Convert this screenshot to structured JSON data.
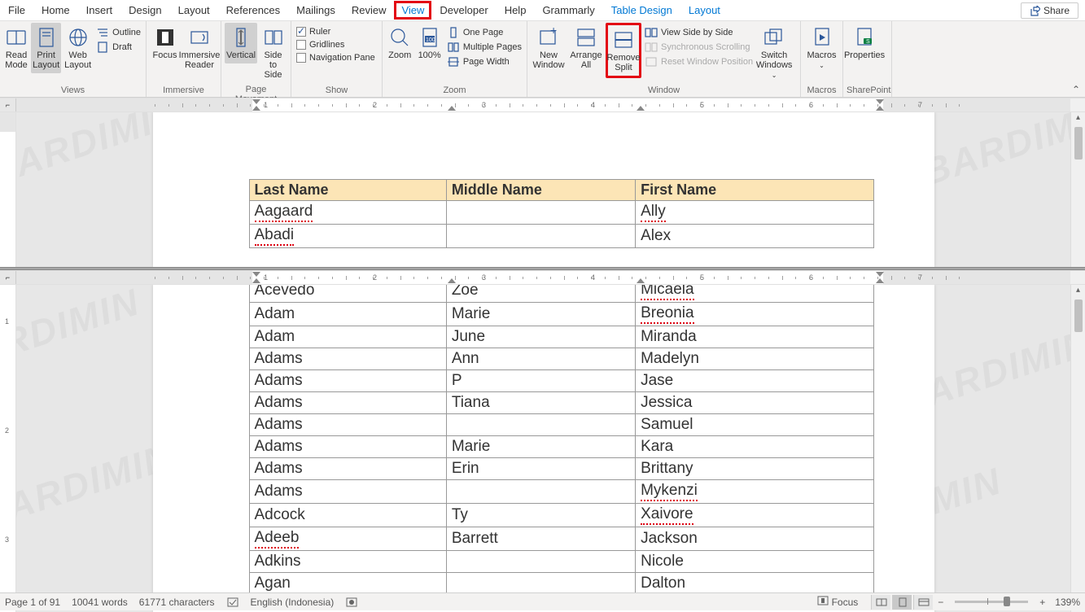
{
  "menu": {
    "items": [
      "File",
      "Home",
      "Insert",
      "Design",
      "Layout",
      "References",
      "Mailings",
      "Review",
      "View",
      "Developer",
      "Help",
      "Grammarly",
      "Table Design",
      "Layout"
    ],
    "share": "Share"
  },
  "ribbon": {
    "groups": {
      "views": {
        "label": "Views",
        "read_mode": "Read Mode",
        "print_layout": "Print Layout",
        "web_layout": "Web Layout",
        "outline": "Outline",
        "draft": "Draft"
      },
      "immersive": {
        "label": "Immersive",
        "focus": "Focus",
        "immersive_reader": "Immersive Reader"
      },
      "page_movement": {
        "label": "Page Movement",
        "vertical": "Vertical",
        "side_to_side": "Side to Side"
      },
      "show": {
        "label": "Show",
        "ruler": "Ruler",
        "gridlines": "Gridlines",
        "navigation_pane": "Navigation Pane"
      },
      "zoom": {
        "label": "Zoom",
        "zoom": "Zoom",
        "p100": "100%",
        "one_page": "One Page",
        "multiple_pages": "Multiple Pages",
        "page_width": "Page Width"
      },
      "window": {
        "label": "Window",
        "new_window": "New Window",
        "arrange_all": "Arrange All",
        "remove_split": "Remove Split",
        "view_side": "View Side by Side",
        "synchronous": "Synchronous Scrolling",
        "reset_position": "Reset Window Position",
        "switch_windows": "Switch Windows"
      },
      "macros": {
        "label": "Macros",
        "macros": "Macros"
      },
      "sharepoint": {
        "label": "SharePoint",
        "properties": "Properties"
      }
    }
  },
  "table": {
    "headers": [
      "Last Name",
      "Middle Name",
      "First Name"
    ],
    "top_rows": [
      {
        "last": "Aagaard",
        "middle": "",
        "first": "Ally",
        "u": [
          0,
          2
        ]
      },
      {
        "last": "Abadi",
        "middle": "",
        "first": "Alex",
        "u": [
          0
        ]
      }
    ],
    "bottom_rows": [
      {
        "last": "Acevedo",
        "middle": "Zoe",
        "first": "Micaela",
        "u": [
          2
        ]
      },
      {
        "last": "Adam",
        "middle": "Marie",
        "first": "Breonia",
        "u": [
          2
        ]
      },
      {
        "last": "Adam",
        "middle": "June",
        "first": "Miranda",
        "u": []
      },
      {
        "last": "Adams",
        "middle": "Ann",
        "first": "Madelyn",
        "u": []
      },
      {
        "last": "Adams",
        "middle": "P",
        "first": "Jase",
        "u": []
      },
      {
        "last": "Adams",
        "middle": "Tiana",
        "first": "Jessica",
        "u": []
      },
      {
        "last": "Adams",
        "middle": "",
        "first": "Samuel",
        "u": []
      },
      {
        "last": "Adams",
        "middle": "Marie",
        "first": "Kara",
        "u": []
      },
      {
        "last": "Adams",
        "middle": "Erin",
        "first": "Brittany",
        "u": []
      },
      {
        "last": "Adams",
        "middle": "",
        "first": "Mykenzi",
        "u": [
          2
        ]
      },
      {
        "last": "Adcock",
        "middle": "Ty",
        "first": "Xaivore",
        "u": [
          2
        ]
      },
      {
        "last": "Adeeb",
        "middle": "Barrett",
        "first": "Jackson",
        "u": [
          0
        ]
      },
      {
        "last": "Adkins",
        "middle": "",
        "first": "Nicole",
        "u": []
      },
      {
        "last": "Agan",
        "middle": "",
        "first": "Dalton",
        "u": []
      }
    ]
  },
  "status": {
    "page": "Page 1 of 91",
    "words": "10041 words",
    "chars": "61771 characters",
    "lang": "English (Indonesia)",
    "focus": "Focus",
    "zoom": "139%"
  }
}
